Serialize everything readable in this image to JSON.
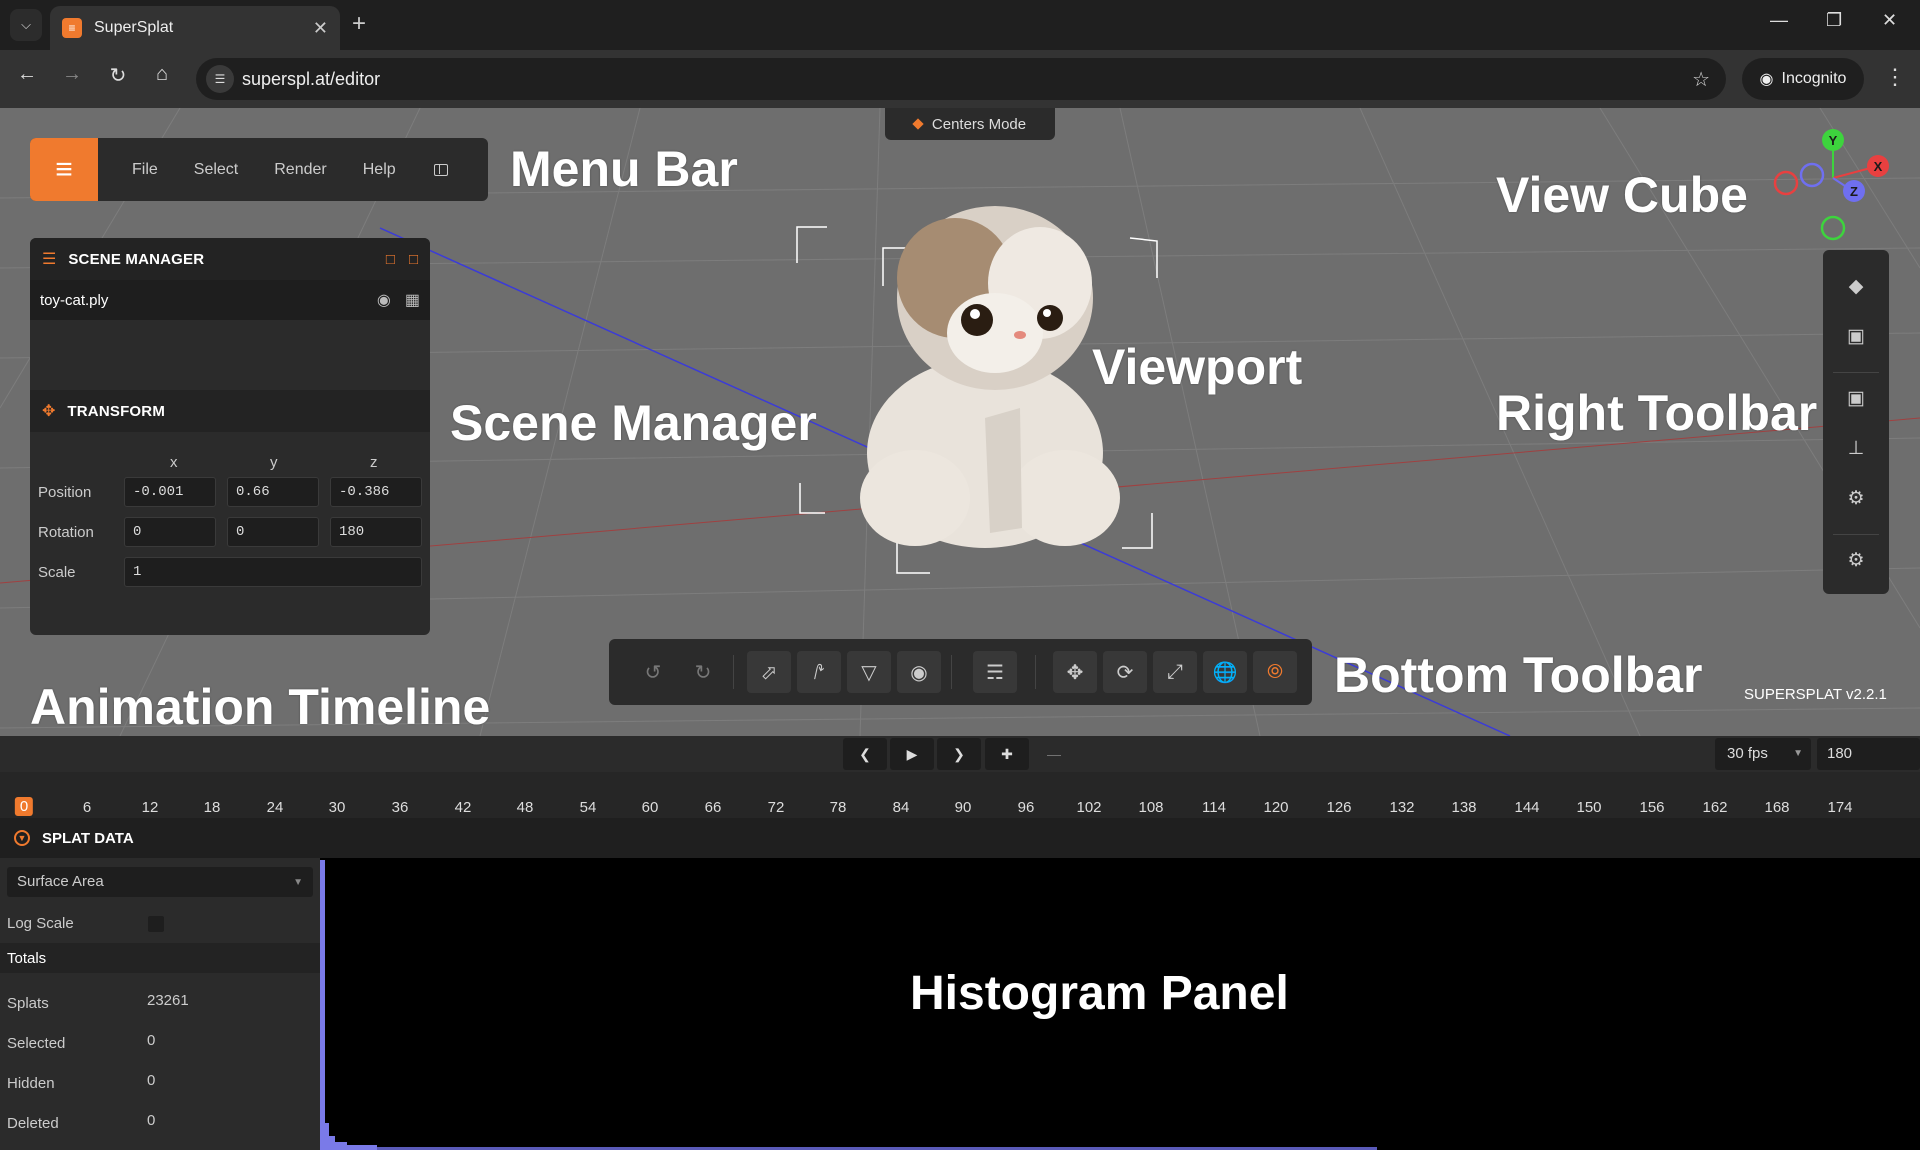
{
  "browser": {
    "tab_title": "SuperSplat",
    "url": "superspl.at/editor",
    "incognito_label": "Incognito"
  },
  "app": {
    "centers_mode": "Centers Mode",
    "menu": [
      "File",
      "Select",
      "Render",
      "Help"
    ],
    "version": "SUPERSPLAT v2.2.1",
    "accent_color": "#f07a2e"
  },
  "scene_manager": {
    "title": "SCENE MANAGER",
    "items": [
      {
        "name": "toy-cat.ply"
      }
    ]
  },
  "transform": {
    "title": "TRANSFORM",
    "axes": [
      "x",
      "y",
      "z"
    ],
    "rows": [
      {
        "label": "Position",
        "values": [
          "-0.001",
          "0.66",
          "-0.386"
        ]
      },
      {
        "label": "Rotation",
        "values": [
          "0",
          "0",
          "180"
        ]
      },
      {
        "label": "Scale",
        "values": [
          "1"
        ]
      }
    ]
  },
  "annotations": {
    "menu_bar": "Menu Bar",
    "view_cube": "View Cube",
    "viewport": "Viewport",
    "scene_manager": "Scene Manager",
    "right_toolbar": "Right Toolbar",
    "bottom_toolbar": "Bottom Toolbar",
    "animation_timeline": "Animation Timeline",
    "histogram_panel": "Histogram Panel"
  },
  "view_cube": {
    "x_label": "X",
    "y_label": "Y",
    "z_label": "Z"
  },
  "timeline": {
    "fps": "30 fps",
    "frames": "180",
    "current_frame": "0",
    "ticks": [
      "6",
      "12",
      "18",
      "24",
      "30",
      "36",
      "42",
      "48",
      "54",
      "60",
      "66",
      "72",
      "78",
      "84",
      "90",
      "96",
      "102",
      "108",
      "114",
      "120",
      "126",
      "132",
      "138",
      "144",
      "150",
      "156",
      "162",
      "168",
      "174"
    ]
  },
  "splat_data": {
    "title": "SPLAT DATA",
    "metric": "Surface Area",
    "log_scale_label": "Log Scale",
    "totals_label": "Totals",
    "stats": [
      {
        "label": "Splats",
        "value": "23261"
      },
      {
        "label": "Selected",
        "value": "0"
      },
      {
        "label": "Hidden",
        "value": "0"
      },
      {
        "label": "Deleted",
        "value": "0"
      }
    ]
  }
}
